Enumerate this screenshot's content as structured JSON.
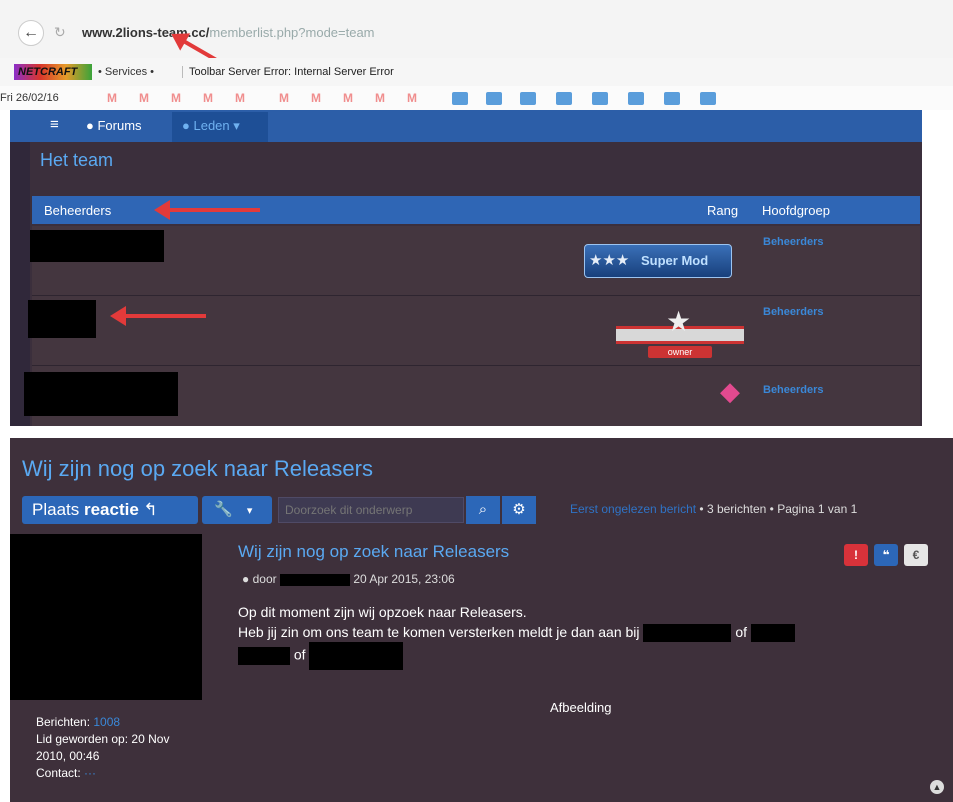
{
  "browser": {
    "url_host": "www.2lions-team.cc/",
    "url_path": "memberlist.php?mode=team"
  },
  "toolbar": {
    "logo": "NETCRAFT",
    "services": "• Services •",
    "error": "Toolbar Server Error: Internal Server Error"
  },
  "date_row": {
    "date": "Fri 26/02/16",
    "mail_icon": "M"
  },
  "nav": {
    "menu_icon": "≡",
    "forums": "Forums",
    "members": "Leden"
  },
  "team": {
    "title": "Het team",
    "header": {
      "name": "Beheerders",
      "rank": "Rang",
      "group": "Hoofdgroep"
    },
    "members": [
      {
        "group": "Beheerders",
        "rank_label": "Super Mod"
      },
      {
        "group": "Beheerders",
        "rank_label": "owner"
      },
      {
        "group": "Beheerders"
      }
    ]
  },
  "topic": {
    "title": "Wij zijn nog op zoek naar Releasers",
    "reply_prefix": "Plaats ",
    "reply_bold": "reactie",
    "search_placeholder": "Doorzoek dit onderwerp",
    "pagination": {
      "unread": "Eerst ongelezen bericht",
      "rest": " • 3 berichten • Pagina 1 van 1"
    }
  },
  "post": {
    "title": "Wij zijn nog op zoek naar Releasers",
    "author_prefix": "door",
    "date": "20 Apr 2015, 23:06",
    "line1": "Op dit moment zijn wij opzoek naar Releasers.",
    "line2": "Heb jij zin om ons team te komen versterken meldt je dan aan bij",
    "or1": "of",
    "or2": "of",
    "image_label": "Afbeelding",
    "buttons": {
      "report": "!",
      "quote": "❝",
      "euro": "€"
    }
  },
  "profile": {
    "posts_label": "Berichten:",
    "posts_value": "1008",
    "joined_label": "Lid geworden op:",
    "joined_value1": "20 Nov",
    "joined_value2": "2010, 00:46",
    "contact_label": "Contact:",
    "contact_value": "···"
  },
  "colors": {
    "nav_blue": "#2c5ea8",
    "link_blue": "#3a88d8",
    "title_blue": "#5aa9f2",
    "panel_bg": "#3b2f3c",
    "annotation_red": "#e23a3a"
  }
}
